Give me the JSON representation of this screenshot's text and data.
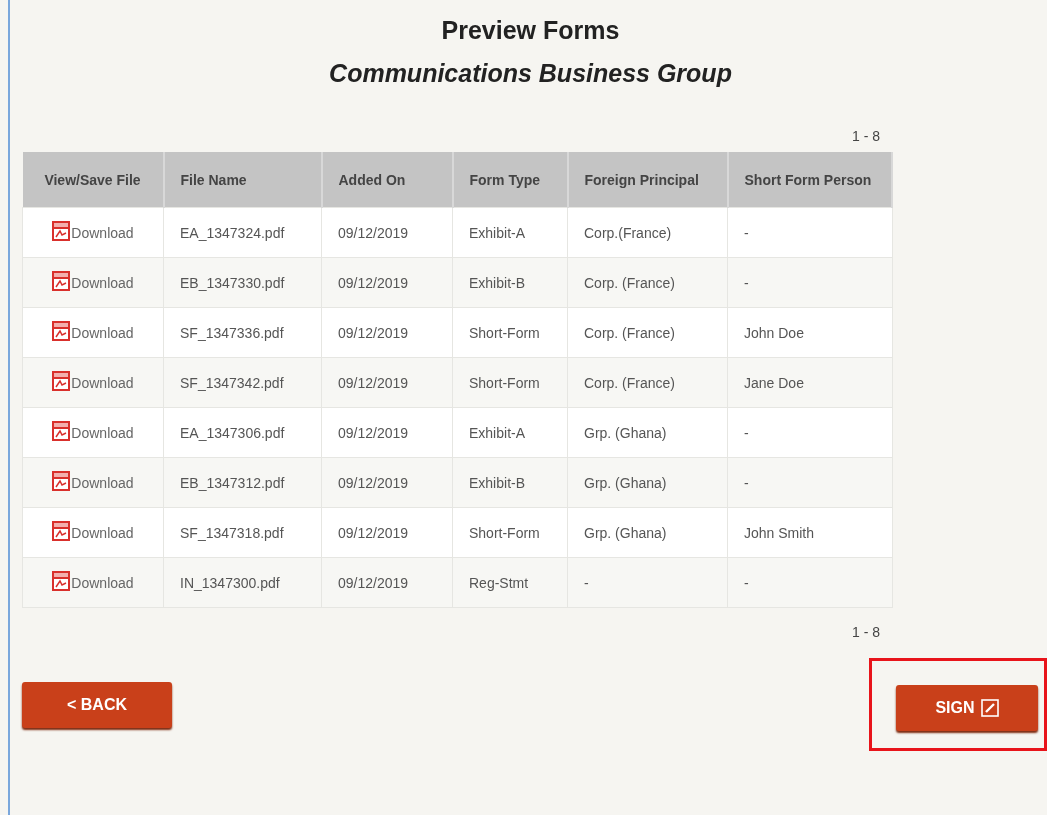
{
  "title": "Preview Forms",
  "subtitle": "Communications Business Group",
  "pagination_top": "1 - 8",
  "table": {
    "columns": [
      "View/Save File",
      "File Name",
      "Added On",
      "Form Type",
      "Foreign Principal",
      "Short Form Person"
    ],
    "rows": [
      {
        "link": "Download",
        "file": "EA_1347324.pdf",
        "added": "09/12/2019",
        "type": "Exhibit-A",
        "principal": "Corp.(France)",
        "person": "-"
      },
      {
        "link": "Download",
        "file": "EB_1347330.pdf",
        "added": "09/12/2019",
        "type": "Exhibit-B",
        "principal": "Corp. (France)",
        "person": "-"
      },
      {
        "link": "Download",
        "file": "SF_1347336.pdf",
        "added": "09/12/2019",
        "type": "Short-Form",
        "principal": "Corp. (France)",
        "person": "John Doe"
      },
      {
        "link": "Download",
        "file": "SF_1347342.pdf",
        "added": "09/12/2019",
        "type": "Short-Form",
        "principal": "Corp. (France)",
        "person": "Jane Doe"
      },
      {
        "link": "Download",
        "file": "EA_1347306.pdf",
        "added": "09/12/2019",
        "type": "Exhibit-A",
        "principal": "Grp. (Ghana)",
        "person": "-"
      },
      {
        "link": "Download",
        "file": "EB_1347312.pdf",
        "added": "09/12/2019",
        "type": "Exhibit-B",
        "principal": "Grp. (Ghana)",
        "person": "-"
      },
      {
        "link": "Download",
        "file": "SF_1347318.pdf",
        "added": "09/12/2019",
        "type": "Short-Form",
        "principal": "Grp. (Ghana)",
        "person": "John Smith"
      },
      {
        "link": "Download",
        "file": "IN_1347300.pdf",
        "added": "09/12/2019",
        "type": "Reg-Stmt",
        "principal": "-",
        "person": "-"
      }
    ]
  },
  "pagination_bottom": "1 - 8",
  "back_button": "< BACK",
  "sign_button": {
    "label": "SIGN",
    "highlighted": true
  }
}
